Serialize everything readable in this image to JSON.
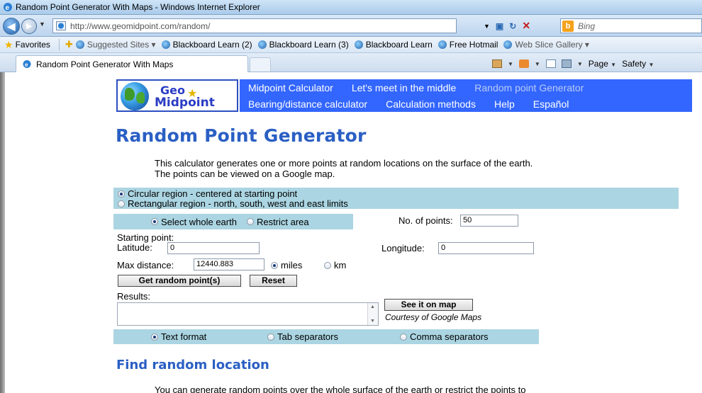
{
  "window": {
    "title": "Random Point Generator With Maps - Windows Internet Explorer"
  },
  "address": {
    "url": "http://www.geomidpoint.com/random/",
    "search_placeholder": "Bing"
  },
  "favorites": {
    "label": "Favorites",
    "links": [
      "Suggested Sites ▾",
      "Blackboard Learn (2)",
      "Blackboard Learn (3)",
      "Blackboard Learn",
      "Free Hotmail",
      "Web Slice Gallery ▾"
    ]
  },
  "tab": {
    "label": "Random Point Generator With Maps"
  },
  "commandbar": {
    "page": "Page",
    "safety": "Safety"
  },
  "site": {
    "logo_line1": "Geo",
    "logo_line2": "Midpoint",
    "menu_row1": [
      "Midpoint Calculator",
      "Let's meet in the middle",
      "Random point Generator"
    ],
    "menu_row2": [
      "Bearing/distance calculator",
      "Calculation methods",
      "Help",
      "Español"
    ]
  },
  "page": {
    "title": "Random Point Generator",
    "intro_line1": "This calculator generates one or more points at random locations on the surface of the earth.",
    "intro_line2": "The points can be viewed on a Google map."
  },
  "form": {
    "region_circular": "Circular region - centered at starting point",
    "region_rectangular": "Rectangular region - north, south, west and east limits",
    "scope_whole": "Select whole earth",
    "scope_restrict": "Restrict area",
    "npoints_label": "No. of points:",
    "npoints_value": "50",
    "starting_point_label": "Starting point:",
    "latitude_label": "Latitude:",
    "latitude_value": "0",
    "longitude_label": "Longitude:",
    "longitude_value": "0",
    "maxdist_label": "Max distance:",
    "maxdist_value": "12440.883",
    "unit_miles": "miles",
    "unit_km": "km",
    "get_button": "Get random point(s)",
    "reset_button": "Reset",
    "results_label": "Results:",
    "map_button": "See it on map",
    "courtesy": "Courtesy of Google Maps",
    "format_text": "Text format",
    "format_tab": "Tab separators",
    "format_comma": "Comma separators"
  },
  "section": {
    "title": "Find random location",
    "text": "You can generate random points over the whole surface of the earth or restrict the points to"
  },
  "colors": {
    "menu_bg": "#3366ff",
    "panel_bg": "#abd5e2",
    "heading": "#2a5fc4"
  }
}
